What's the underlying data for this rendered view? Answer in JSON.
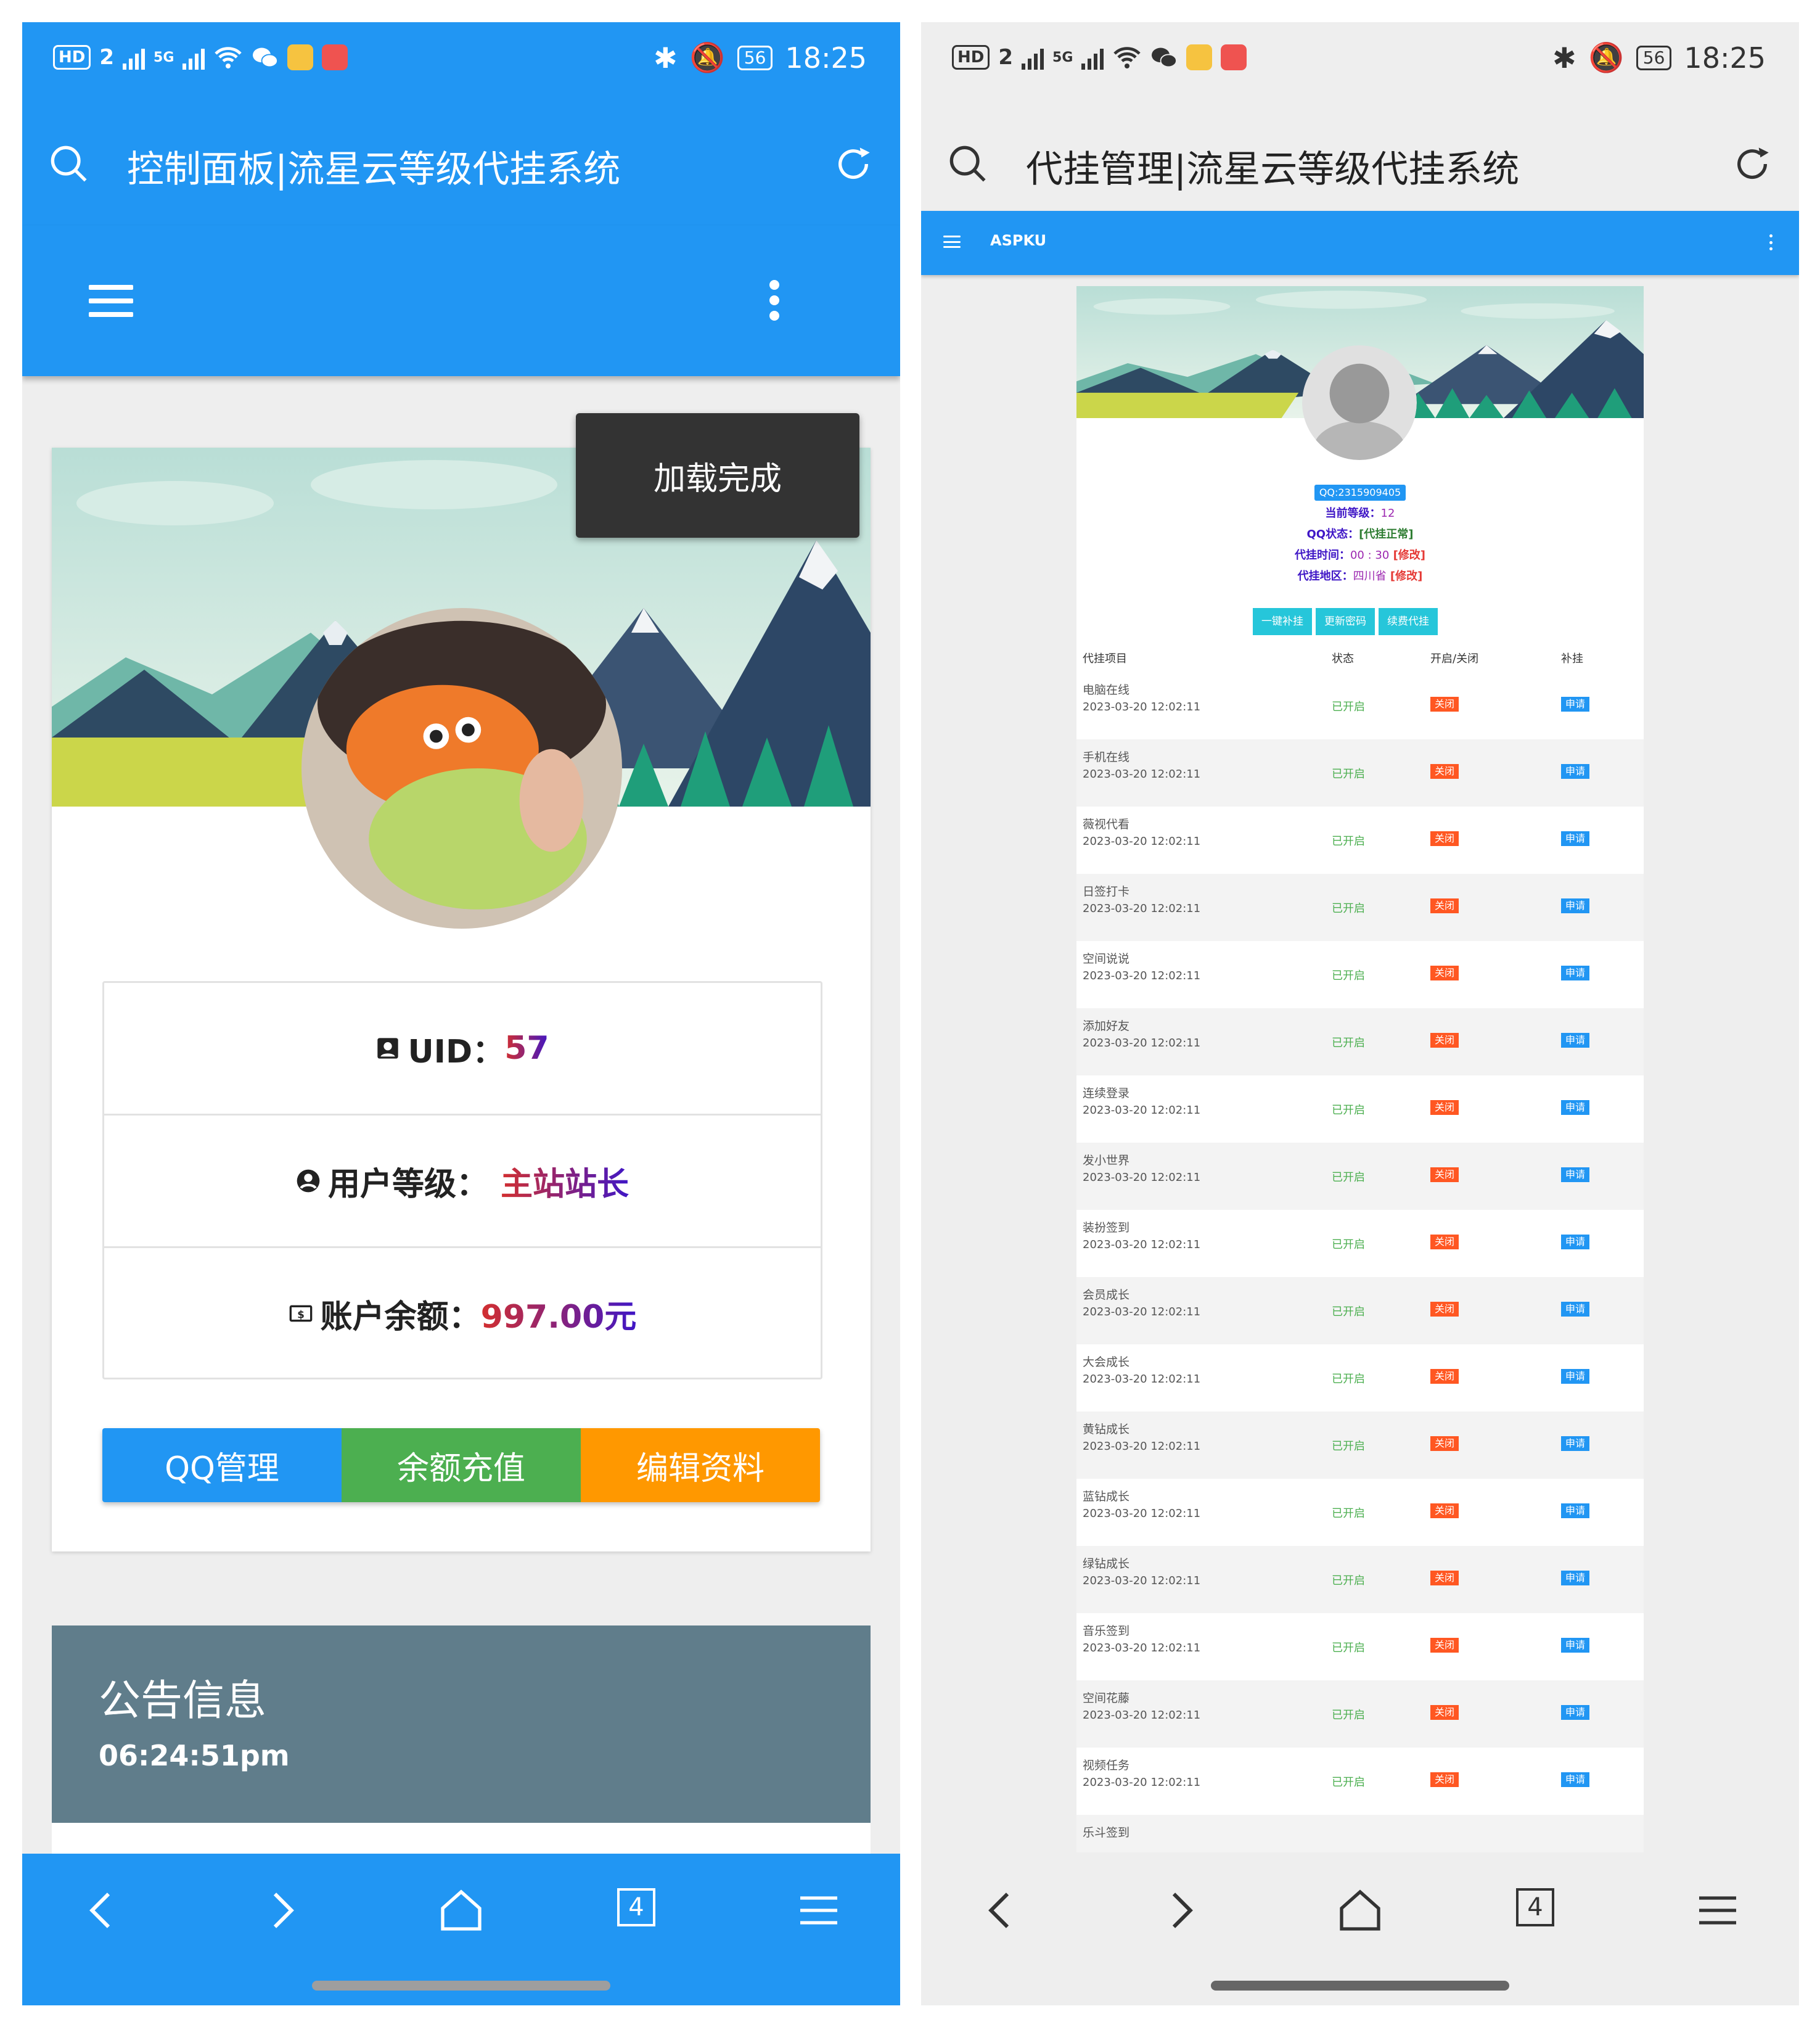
{
  "left": {
    "status_bar": {
      "hd": "HD",
      "sim": "2",
      "signal_5g": "5G",
      "battery": "56",
      "time": "18:25"
    },
    "url_title": "控制面板|流星云等级代挂系统",
    "toast": "加载完成",
    "profile": {
      "uid_label": "UID：",
      "uid_value": "57",
      "level_label": "用户等级：",
      "level_value": "主站站长",
      "balance_label": "账户余额：",
      "balance_value": "997.00元"
    },
    "buttons": [
      {
        "label": "QQ管理",
        "color": "#2196f3"
      },
      {
        "label": "余额充值",
        "color": "#4caf50"
      },
      {
        "label": "编辑资料",
        "color": "#ff9800"
      }
    ],
    "notice": {
      "title": "公告信息",
      "time": "06:24:51pm"
    },
    "tab_count": "4"
  },
  "right": {
    "status_bar": {
      "hd": "HD",
      "sim": "2",
      "signal_5g": "5G",
      "battery": "56",
      "time": "18:25"
    },
    "url_title": "代挂管理|流星云等级代挂系统",
    "brand": "ASPKU",
    "qq": "QQ:2315909405",
    "info": {
      "level_label": "当前等级：",
      "level_value": "12",
      "qq_state_label": "QQ状态：",
      "qq_state_value": "[代挂正常]",
      "time_label": "代挂时间：",
      "time_value": "00 : 30",
      "time_edit": "[修改]",
      "region_label": "代挂地区：",
      "region_value": "四川省",
      "region_edit": "[修改]"
    },
    "actions": [
      "一键补挂",
      "更新密码",
      "续费代挂"
    ],
    "table_headers": [
      "代挂项目",
      "状态",
      "开启/关闭",
      "补挂"
    ],
    "rows": [
      {
        "name": "电脑在线",
        "time": "2023-03-20 12:02:11",
        "status": "已开启",
        "toggle": "关闭",
        "apply": "申请"
      },
      {
        "name": "手机在线",
        "time": "2023-03-20 12:02:11",
        "status": "已开启",
        "toggle": "关闭",
        "apply": "申请"
      },
      {
        "name": "薇视代看",
        "time": "2023-03-20 12:02:11",
        "status": "已开启",
        "toggle": "关闭",
        "apply": "申请"
      },
      {
        "name": "日签打卡",
        "time": "2023-03-20 12:02:11",
        "status": "已开启",
        "toggle": "关闭",
        "apply": "申请"
      },
      {
        "name": "空间说说",
        "time": "2023-03-20 12:02:11",
        "status": "已开启",
        "toggle": "关闭",
        "apply": "申请"
      },
      {
        "name": "添加好友",
        "time": "2023-03-20 12:02:11",
        "status": "已开启",
        "toggle": "关闭",
        "apply": "申请"
      },
      {
        "name": "连续登录",
        "time": "2023-03-20 12:02:11",
        "status": "已开启",
        "toggle": "关闭",
        "apply": "申请"
      },
      {
        "name": "发小世界",
        "time": "2023-03-20 12:02:11",
        "status": "已开启",
        "toggle": "关闭",
        "apply": "申请"
      },
      {
        "name": "装扮签到",
        "time": "2023-03-20 12:02:11",
        "status": "已开启",
        "toggle": "关闭",
        "apply": "申请"
      },
      {
        "name": "会员成长",
        "time": "2023-03-20 12:02:11",
        "status": "已开启",
        "toggle": "关闭",
        "apply": "申请"
      },
      {
        "name": "大会成长",
        "time": "2023-03-20 12:02:11",
        "status": "已开启",
        "toggle": "关闭",
        "apply": "申请"
      },
      {
        "name": "黄钻成长",
        "time": "2023-03-20 12:02:11",
        "status": "已开启",
        "toggle": "关闭",
        "apply": "申请"
      },
      {
        "name": "蓝钻成长",
        "time": "2023-03-20 12:02:11",
        "status": "已开启",
        "toggle": "关闭",
        "apply": "申请"
      },
      {
        "name": "绿钻成长",
        "time": "2023-03-20 12:02:11",
        "status": "已开启",
        "toggle": "关闭",
        "apply": "申请"
      },
      {
        "name": "音乐签到",
        "time": "2023-03-20 12:02:11",
        "status": "已开启",
        "toggle": "关闭",
        "apply": "申请"
      },
      {
        "name": "空间花藤",
        "time": "2023-03-20 12:02:11",
        "status": "已开启",
        "toggle": "关闭",
        "apply": "申请"
      },
      {
        "name": "视频任务",
        "time": "2023-03-20 12:02:11",
        "status": "已开启",
        "toggle": "关闭",
        "apply": "申请"
      },
      {
        "name": "乐斗签到",
        "time": "",
        "status": "",
        "toggle": "",
        "apply": ""
      }
    ],
    "tab_count": "4"
  },
  "colors": {
    "primary": "#2196f3",
    "green": "#4caf50",
    "orange": "#ff9800",
    "danger": "#ff5722",
    "notice": "#607d8b"
  }
}
